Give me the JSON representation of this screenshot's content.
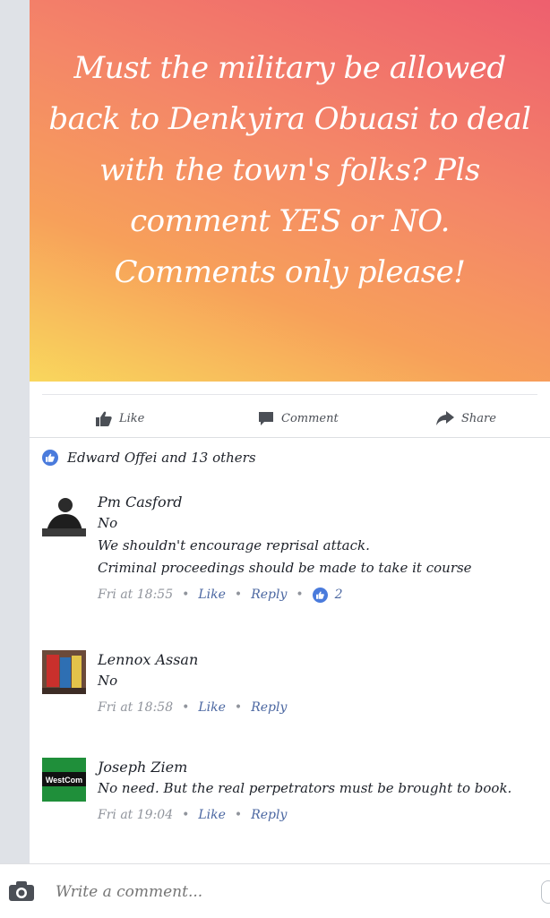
{
  "post": {
    "text": "Must the military be allowed back to Denkyira Obuasi to deal with the town's folks? Pls comment YES or NO. Comments only please!",
    "gradient": [
      "#f9d75d",
      "#f7a05a",
      "#f48668",
      "#ee5f6e"
    ]
  },
  "actions": {
    "like": "Like",
    "comment": "Comment",
    "share": "Share"
  },
  "reactions": {
    "summary": "Edward Offei and 13 others",
    "like_color": "#4a7bdc"
  },
  "comments": [
    {
      "name": "Pm Casford",
      "lines": [
        "No",
        "We shouldn't encourage reprisal attack.",
        "Criminal proceedings should be made to take it course"
      ],
      "time": "Fri at 18:55",
      "like": "Like",
      "reply": "Reply",
      "likes": "2"
    },
    {
      "name": "Lennox Assan",
      "lines": [
        "No"
      ],
      "time": "Fri at 18:58",
      "like": "Like",
      "reply": "Reply"
    },
    {
      "name": "Joseph Ziem",
      "lines": [
        "No need. But the real perpetrators must be brought to book."
      ],
      "time": "Fri at 19:04",
      "like": "Like",
      "reply": "Reply",
      "avatar_text": "WestCom"
    }
  ],
  "composer": {
    "placeholder": "Write a comment..."
  }
}
